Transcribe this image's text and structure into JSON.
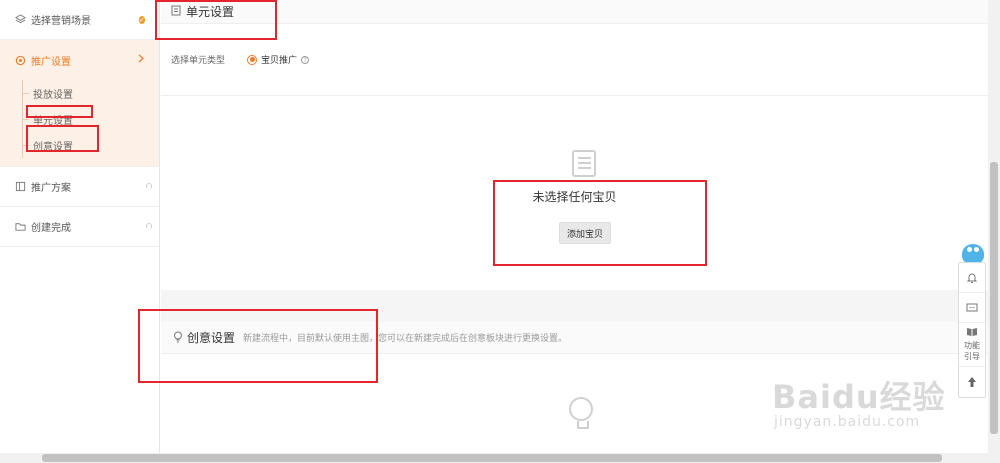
{
  "sidebar": {
    "items": [
      {
        "label": "选择营销场景"
      },
      {
        "label": "推广设置"
      },
      {
        "label": "推广方案"
      },
      {
        "label": "创建完成"
      }
    ],
    "sub_items": [
      {
        "label": "投放设置"
      },
      {
        "label": "单元设置"
      },
      {
        "label": "创意设置"
      }
    ]
  },
  "unit": {
    "title": "单元设置",
    "type_label": "选择单元类型",
    "radio_option": "宝贝推广",
    "empty_text": "未选择任何宝贝",
    "add_button": "添加宝贝"
  },
  "creative": {
    "title": "创意设置",
    "description": "新建流程中，目前默认使用主图，您可以在新建完成后在创意板块进行更换设置。"
  },
  "float_bar": {
    "guide_line1": "功能",
    "guide_line2": "引导"
  },
  "watermark": {
    "brand": "Baidu经验",
    "url": "jingyan.baidu.com"
  },
  "colors": {
    "accent": "#f07a24",
    "annotation": "#e4262c"
  }
}
